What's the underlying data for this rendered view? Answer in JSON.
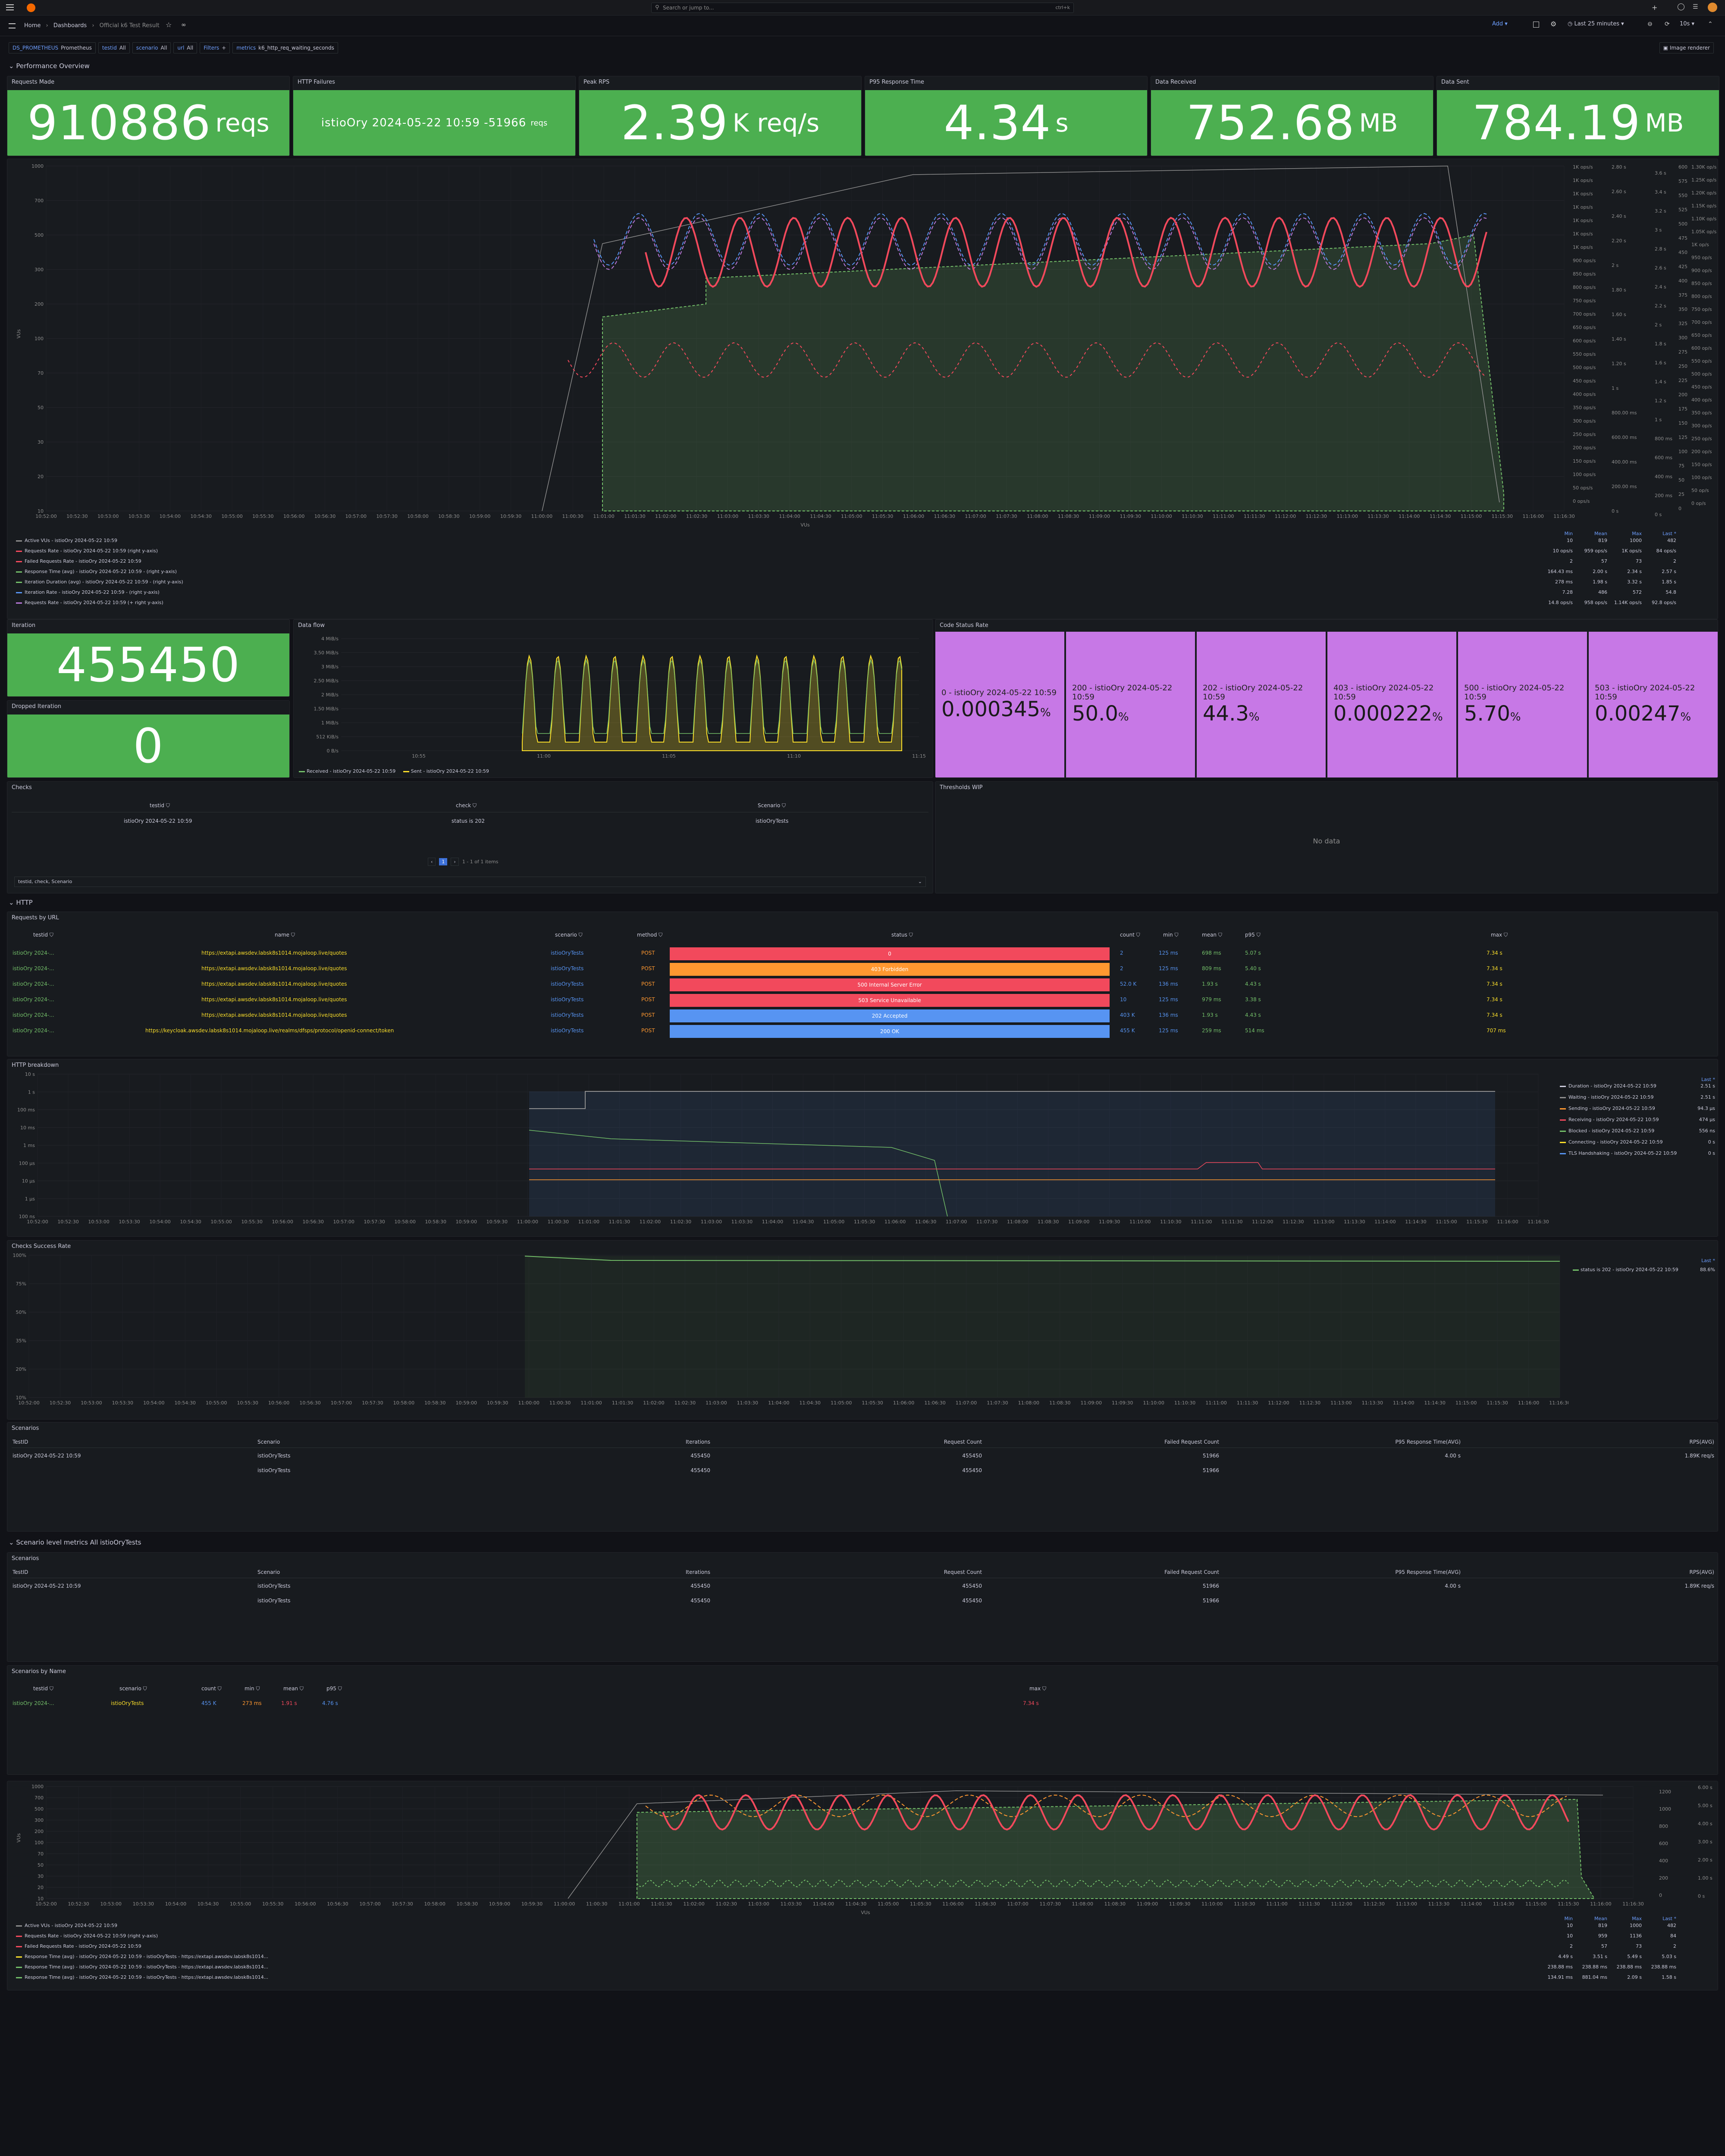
{
  "search": {
    "placeholder": "Search or jump to...",
    "shortcut": "ctrl+k"
  },
  "breadcrumb": {
    "home": "Home",
    "dashboards": "Dashboards",
    "current": "Official k6 Test Result"
  },
  "toolbar": {
    "add": "Add",
    "time_range": "Last 25 minutes",
    "refresh": "10s"
  },
  "variables": [
    {
      "key": "DS_PROMETHEUS",
      "value": "Prometheus"
    },
    {
      "key": "testid",
      "value": "All"
    },
    {
      "key": "scenario",
      "value": "All"
    },
    {
      "key": "url",
      "value": "All"
    },
    {
      "key": "Filters",
      "value": "+"
    },
    {
      "key": "metrics",
      "value": "k6_http_req_waiting_seconds"
    }
  ],
  "image_renderer": "Image renderer",
  "rows": {
    "performance": "Performance Overview",
    "http": "HTTP",
    "scenario_level": "Scenario level metrics All istioOryTests"
  },
  "stats": [
    {
      "title": "Requests Made",
      "value": "910886",
      "unit": "reqs"
    },
    {
      "title": "HTTP Failures",
      "value": "istioOry 2024-05-22 10:59 -51966",
      "unit": "reqs"
    },
    {
      "title": "Peak RPS",
      "value": "2.39",
      "unit": "K req/s"
    },
    {
      "title": "P95 Response Time",
      "value": "4.34",
      "unit": "s"
    },
    {
      "title": "Data Received",
      "value": "752.68",
      "unit": "MB"
    },
    {
      "title": "Data Sent",
      "value": "784.19",
      "unit": "MB"
    }
  ],
  "perf_chart": {
    "x_ticks": [
      "10:52:00",
      "10:52:30",
      "10:53:00",
      "10:53:30",
      "10:54:00",
      "10:54:30",
      "10:55:00",
      "10:55:30",
      "10:56:00",
      "10:56:30",
      "10:57:00",
      "10:57:30",
      "10:58:00",
      "10:58:30",
      "10:59:00",
      "10:59:30",
      "11:00:00",
      "11:00:30",
      "11:01:00",
      "11:01:30",
      "11:02:00",
      "11:02:30",
      "11:03:00",
      "11:03:30",
      "11:04:00",
      "11:04:30",
      "11:05:00",
      "11:05:30",
      "11:06:00",
      "11:06:30",
      "11:07:00",
      "11:07:30",
      "11:08:00",
      "11:08:30",
      "11:09:00",
      "11:09:30",
      "11:10:00",
      "11:10:30",
      "11:11:00",
      "11:11:30",
      "11:12:00",
      "11:12:30",
      "11:13:00",
      "11:13:30",
      "11:14:00",
      "11:14:30",
      "11:15:00",
      "11:15:30",
      "11:16:00",
      "11:16:30"
    ],
    "y_ticks": [
      "1000",
      "700",
      "500",
      "300",
      "200",
      "100",
      "70",
      "50",
      "30",
      "20",
      "10"
    ],
    "ylabel": "VUs",
    "xlabel": "VUs",
    "legend_headers": [
      "Min",
      "Mean",
      "Max",
      "Last *"
    ],
    "legend": [
      {
        "name": "Active VUs - istioOry 2024-05-22 10:59",
        "color": "#8e8e8e",
        "vals": [
          "10",
          "819",
          "1000",
          "482"
        ]
      },
      {
        "name": "Requests Rate - istioOry 2024-05-22 10:59 (right y-axis)",
        "color": "#f2495c",
        "vals": [
          "10 ops/s",
          "959 ops/s",
          "1K ops/s",
          "84 ops/s"
        ]
      },
      {
        "name": "Failed Requests Rate - istioOry 2024-05-22 10:59",
        "color": "#f2495c",
        "vals": [
          "2",
          "57",
          "73",
          "2"
        ]
      },
      {
        "name": "Response Time (avg) - istioOry 2024-05-22 10:59 - (right y-axis)",
        "color": "#73bf69",
        "vals": [
          "164.43 ms",
          "2.00 s",
          "2.34 s",
          "2.57 s"
        ]
      },
      {
        "name": "Iteration Duration (avg) - istioOry 2024-05-22 10:59 - (right y-axis)",
        "color": "#73bf69",
        "vals": [
          "278 ms",
          "1.98 s",
          "3.32 s",
          "1.85 s"
        ]
      },
      {
        "name": "Iteration Rate - istioOry 2024-05-22 10:59 - (right y-axis)",
        "color": "#5794f2",
        "vals": [
          "7.28",
          "486",
          "572",
          "54.8"
        ]
      },
      {
        "name": "Requests Rate - istioOry 2024-05-22 10:59 (+ right y-axis)",
        "color": "#b877d9",
        "vals": [
          "14.8 ops/s",
          "958 ops/s",
          "1.14K ops/s",
          "92.8 ops/s"
        ]
      }
    ]
  },
  "iteration": {
    "title": "Iteration",
    "value": "455450"
  },
  "dropped": {
    "title": "Dropped Iteration",
    "value": "0"
  },
  "dataflow": {
    "title": "Data flow",
    "y_ticks": [
      "4 MiB/s",
      "3.50 MiB/s",
      "3 MiB/s",
      "2.50 MiB/s",
      "2 MiB/s",
      "1.50 MiB/s",
      "1 MiB/s",
      "512 KiB/s",
      "0 B/s"
    ],
    "x_ticks": [
      "10:55",
      "11:00",
      "11:05",
      "11:10",
      "11:15"
    ],
    "legend": [
      "Received - istioOry 2024-05-22 10:59",
      "Sent - istioOry 2024-05-22 10:59"
    ]
  },
  "code_status": {
    "title": "Code Status Rate",
    "items": [
      {
        "label": "0 - istioOry 2024-05-22 10:59",
        "value": "0.000345",
        "unit": "%"
      },
      {
        "label": "200 - istioOry 2024-05-22 10:59",
        "value": "50.0",
        "unit": "%"
      },
      {
        "label": "202 - istioOry 2024-05-22 10:59",
        "value": "44.3",
        "unit": "%"
      },
      {
        "label": "403 - istioOry 2024-05-22 10:59",
        "value": "0.000222",
        "unit": "%"
      },
      {
        "label": "500 - istioOry 2024-05-22 10:59",
        "value": "5.70",
        "unit": "%"
      },
      {
        "label": "503 - istioOry 2024-05-22 10:59",
        "value": "0.00247",
        "unit": "%"
      }
    ]
  },
  "checks": {
    "title": "Checks",
    "headers": [
      "testid",
      "check",
      "Scenario"
    ],
    "row": [
      "istioOry 2024-05-22 10:59",
      "status is 202",
      "istioOryTests"
    ],
    "page": "1",
    "page_info": "1 - 1 of 1 items",
    "footer": "testid, check, Scenario"
  },
  "thresholds": {
    "title": "Thresholds WIP",
    "empty": "No data"
  },
  "requests_by_url": {
    "title": "Requests by URL",
    "headers": [
      "testid",
      "name",
      "scenario",
      "method",
      "status",
      "count",
      "min",
      "mean",
      "p95",
      "max"
    ],
    "rows": [
      {
        "testid": "istioOry 2024-...",
        "name": "https://extapi.awsdev.labsk8s1014.mojaloop.live/quotes",
        "scenario": "istioOryTests",
        "method": "POST",
        "status": "0",
        "status_color": "#f2495c",
        "count": "2",
        "min": "125 ms",
        "mean": "698 ms",
        "p95": "5.07 s",
        "max": "7.34 s"
      },
      {
        "testid": "istioOry 2024-...",
        "name": "https://extapi.awsdev.labsk8s1014.mojaloop.live/quotes",
        "scenario": "istioOryTests",
        "method": "POST",
        "status": "403 Forbidden",
        "status_color": "#ff9830",
        "count": "2",
        "min": "125 ms",
        "mean": "809 ms",
        "p95": "5.40 s",
        "max": "7.34 s"
      },
      {
        "testid": "istioOry 2024-...",
        "name": "https://extapi.awsdev.labsk8s1014.mojaloop.live/quotes",
        "scenario": "istioOryTests",
        "method": "POST",
        "status": "500 Internal Server Error",
        "status_color": "#f2495c",
        "count": "52.0 K",
        "min": "136 ms",
        "mean": "1.93 s",
        "p95": "4.43 s",
        "max": "7.34 s"
      },
      {
        "testid": "istioOry 2024-...",
        "name": "https://extapi.awsdev.labsk8s1014.mojaloop.live/quotes",
        "scenario": "istioOryTests",
        "method": "POST",
        "status": "503 Service Unavailable",
        "status_color": "#f2495c",
        "count": "10",
        "min": "125 ms",
        "mean": "979 ms",
        "p95": "3.38 s",
        "max": "7.34 s"
      },
      {
        "testid": "istioOry 2024-...",
        "name": "https://extapi.awsdev.labsk8s1014.mojaloop.live/quotes",
        "scenario": "istioOryTests",
        "method": "POST",
        "status": "202 Accepted",
        "status_color": "#5794f2",
        "count": "403 K",
        "min": "136 ms",
        "mean": "1.93 s",
        "p95": "4.43 s",
        "max": "7.34 s"
      },
      {
        "testid": "istioOry 2024-...",
        "name": "https://keycloak.awsdev.labsk8s1014.mojaloop.live/realms/dfsps/protocol/openid-connect/token",
        "scenario": "istioOryTests",
        "method": "POST",
        "status": "200 OK",
        "status_color": "#5794f2",
        "count": "455 K",
        "min": "125 ms",
        "mean": "259 ms",
        "p95": "514 ms",
        "max": "707 ms"
      }
    ]
  },
  "http_breakdown": {
    "title": "HTTP breakdown",
    "y_ticks": [
      "10 s",
      "1 s",
      "100 ms",
      "10 ms",
      "1 ms",
      "100 µs",
      "10 µs",
      "1 µs",
      "100 ns"
    ],
    "legend_header": "Last *",
    "legend": [
      {
        "name": "Duration - istioOry 2024-05-22 10:59",
        "color": "#ccccdc",
        "val": "2.51 s"
      },
      {
        "name": "Waiting - istioOry 2024-05-22 10:59",
        "color": "#8e8e8e",
        "val": "2.51 s"
      },
      {
        "name": "Sending - istioOry 2024-05-22 10:59",
        "color": "#ff9830",
        "val": "94.3 µs"
      },
      {
        "name": "Receiving - istioOry 2024-05-22 10:59",
        "color": "#f2495c",
        "val": "474 µs"
      },
      {
        "name": "Blocked - istioOry 2024-05-22 10:59",
        "color": "#73bf69",
        "val": "556 ns"
      },
      {
        "name": "Connecting - istioOry 2024-05-22 10:59",
        "color": "#fade2a",
        "val": "0 s"
      },
      {
        "name": "TLS Handshaking - istioOry 2024-05-22 10:59",
        "color": "#5794f2",
        "val": "0 s"
      }
    ]
  },
  "checks_success": {
    "title": "Checks Success Rate",
    "y_ticks": [
      "100%",
      "75%",
      "50%",
      "35%",
      "20%",
      "10%"
    ],
    "legend_header": "Last *",
    "legend": {
      "name": "status is 202 - istioOry 2024-05-22 10:59",
      "val": "88.6%"
    }
  },
  "scenarios_table": {
    "title": "Scenarios",
    "headers": [
      "TestID",
      "Scenario",
      "Iterations",
      "Request Count",
      "Failed Request Count",
      "P95 Response Time(AVG)",
      "RPS(AVG)"
    ],
    "rows": [
      [
        "istioOry 2024-05-22 10:59",
        "istioOryTests",
        "455450",
        "455450",
        "51966",
        "4.00 s",
        "1.89K req/s"
      ],
      [
        "",
        "istioOryTests",
        "455450",
        "455450",
        "51966",
        "",
        ""
      ]
    ]
  },
  "scenarios_table2": {
    "title": "Scenarios",
    "headers": [
      "TestID",
      "Scenario",
      "Iterations",
      "Request Count",
      "Failed Request Count",
      "P95 Response Time(AVG)",
      "RPS(AVG)"
    ],
    "rows": [
      [
        "istioOry 2024-05-22 10:59",
        "istioOryTests",
        "455450",
        "455450",
        "51966",
        "4.00 s",
        "1.89K req/s"
      ],
      [
        "",
        "istioOryTests",
        "455450",
        "455450",
        "51966",
        "",
        ""
      ]
    ]
  },
  "scenarios_by_name": {
    "title": "Scenarios by Name",
    "headers": [
      "testid",
      "scenario",
      "count",
      "min",
      "mean",
      "p95",
      "max"
    ],
    "row": [
      "istioOry 2024-...",
      "istioOryTests",
      "455 K",
      "273 ms",
      "1.91 s",
      "4.76 s",
      "7.34 s"
    ]
  },
  "bottom_chart": {
    "y_ticks": [
      "1000",
      "700",
      "500",
      "300",
      "200",
      "100",
      "70",
      "50",
      "30",
      "20",
      "10"
    ],
    "ylabel": "VUs",
    "legend_headers": [
      "Min",
      "Mean",
      "Max",
      "Last *"
    ],
    "legend": [
      {
        "name": "Active VUs - istioOry 2024-05-22 10:59",
        "color": "#8e8e8e",
        "vals": [
          "10",
          "819",
          "1000",
          "482"
        ]
      },
      {
        "name": "Requests Rate - istioOry 2024-05-22 10:59 (right y-axis)",
        "color": "#f2495c",
        "vals": [
          "10",
          "959",
          "1136",
          "84"
        ]
      },
      {
        "name": "Failed Requests Rate - istioOry 2024-05-22 10:59",
        "color": "#f2495c",
        "vals": [
          "2",
          "57",
          "73",
          "2"
        ]
      },
      {
        "name": "Response Time (avg) - istioOry 2024-05-22 10:59 - istioOryTests - https://extapi.awsdev.labsk8s1014...",
        "color": "#fade2a",
        "vals": [
          "4.49 s",
          "3.51 s",
          "5.49 s",
          "5.03 s"
        ]
      },
      {
        "name": "Response Time (avg) - istioOry 2024-05-22 10:59 - istioOryTests - https://extapi.awsdev.labsk8s1014...",
        "color": "#73bf69",
        "vals": [
          "238.88 ms",
          "238.88 ms",
          "238.88 ms",
          "238.88 ms"
        ]
      },
      {
        "name": "Response Time (avg) - istioOry 2024-05-22 10:59 - istioOryTests - https://extapi.awsdev.labsk8s1014...",
        "color": "#73bf69",
        "vals": [
          "134.91 ms",
          "881.04 ms",
          "2.09 s",
          "1.58 s"
        ]
      }
    ]
  }
}
